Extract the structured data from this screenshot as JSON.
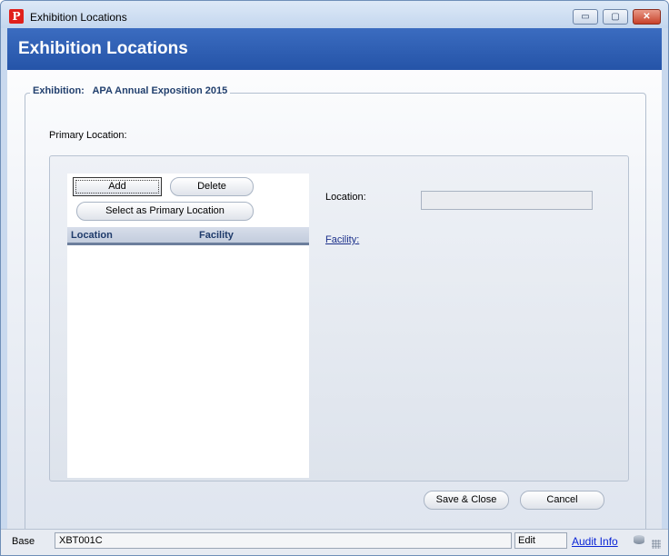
{
  "window": {
    "title": "Exhibition Locations",
    "app_icon": "P",
    "controls": {
      "minimize": "▭",
      "maximize": "▢",
      "close": "✕"
    }
  },
  "header": {
    "title": "Exhibition Locations"
  },
  "exhibition": {
    "label": "Exhibition:",
    "name": "APA Annual Exposition 2015"
  },
  "primary_location": {
    "label": "Primary Location:"
  },
  "list": {
    "buttons": {
      "add": "Add",
      "delete": "Delete",
      "select_primary": "Select as Primary Location"
    },
    "columns": [
      "Location",
      "Facility"
    ],
    "rows": []
  },
  "detail": {
    "location_label": "Location:",
    "location_value": "",
    "facility_link": "Facility:"
  },
  "footer": {
    "save_close": "Save & Close",
    "cancel": "Cancel"
  },
  "statusbar": {
    "base": "Base",
    "code": "XBT001C",
    "mode": "Edit",
    "audit_info": "Audit Info"
  },
  "colors": {
    "header_banner": "#2554a8",
    "link": "#1a2f8a",
    "close_button": "#c7412a"
  }
}
